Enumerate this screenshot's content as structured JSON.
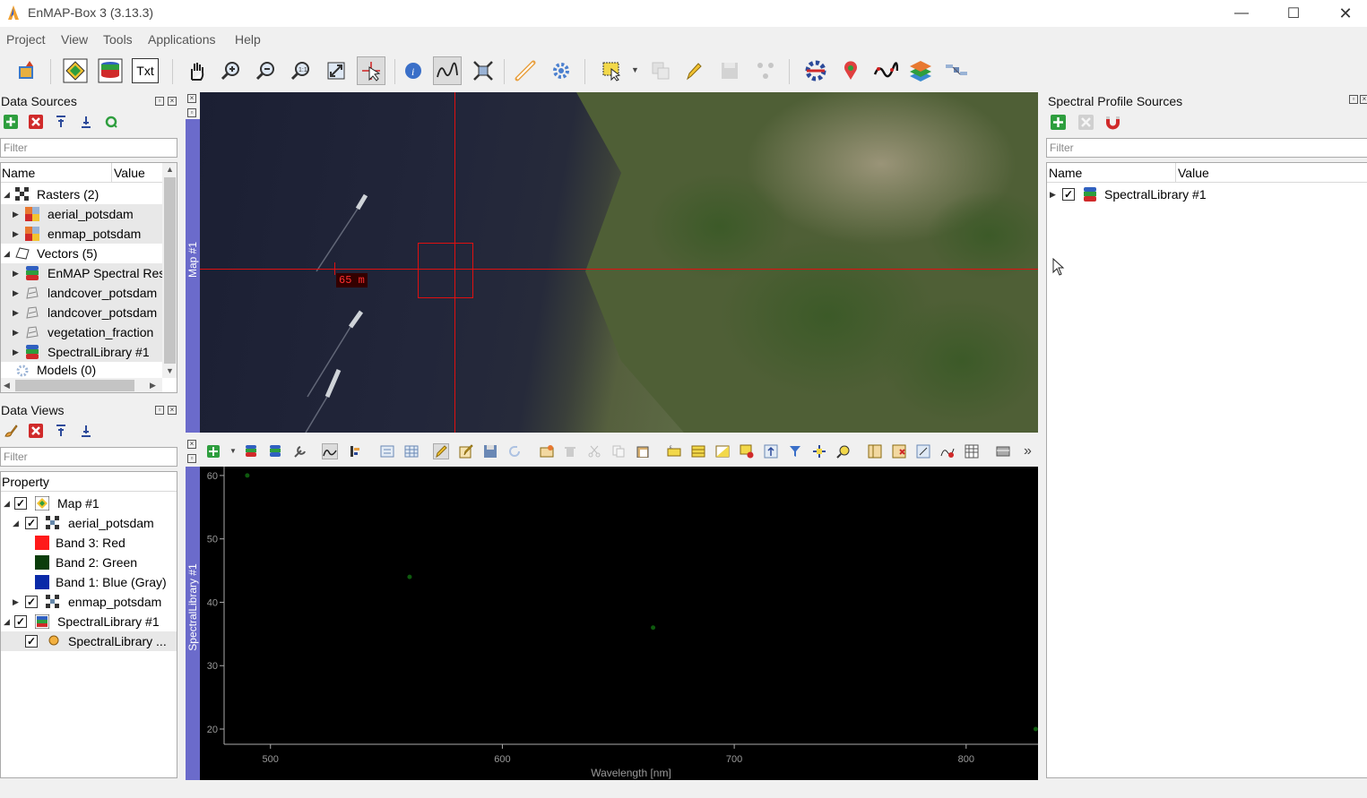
{
  "app": {
    "title": "EnMAP-Box 3 (3.13.3)"
  },
  "window_controls": {
    "minimize": "—",
    "maximize": "☐",
    "close": "✕"
  },
  "menu": [
    "Project",
    "View",
    "Tools",
    "Applications",
    "Help"
  ],
  "toolbar": {
    "txt_label": "Txt"
  },
  "data_sources": {
    "title": "Data Sources",
    "filter_placeholder": "Filter",
    "columns": [
      "Name",
      "Value"
    ],
    "items": [
      {
        "label": "Rasters (2)"
      },
      {
        "label": "aerial_potsdam"
      },
      {
        "label": "enmap_potsdam"
      },
      {
        "label": "Vectors (5)"
      },
      {
        "label": "EnMAP Spectral Res"
      },
      {
        "label": "landcover_potsdam"
      },
      {
        "label": "landcover_potsdam"
      },
      {
        "label": "vegetation_fraction"
      },
      {
        "label": "SpectralLibrary #1"
      },
      {
        "label": "Models (0)"
      }
    ]
  },
  "data_views": {
    "title": "Data Views",
    "filter_placeholder": "Filter",
    "column": "Property",
    "items": [
      {
        "label": "Map #1"
      },
      {
        "label": "aerial_potsdam"
      },
      {
        "label": "Band 3: Red",
        "color": "#ff1a1a"
      },
      {
        "label": "Band 2: Green",
        "color": "#0b3d0b"
      },
      {
        "label": "Band 1: Blue (Gray)",
        "color": "#0a2aa8"
      },
      {
        "label": "enmap_potsdam"
      },
      {
        "label": "SpectralLibrary #1"
      },
      {
        "label": "SpectralLibrary ..."
      }
    ]
  },
  "map": {
    "sidebar_label": "Map #1",
    "scale_text": "65 m"
  },
  "spectral_library": {
    "sidebar_label": "SpectralLibrary #1"
  },
  "chart_data": {
    "type": "scatter",
    "xlabel": "Wavelength [nm]",
    "ylabel": "",
    "xlim": [
      480,
      831
    ],
    "ylim": [
      17.6,
      61.4
    ],
    "x_ticks": [
      500,
      600,
      700,
      800
    ],
    "y_ticks": [
      20,
      30,
      40,
      50,
      60
    ],
    "grid": false,
    "points": [
      {
        "x": 490,
        "y": 60
      },
      {
        "x": 560,
        "y": 44
      },
      {
        "x": 665,
        "y": 36
      },
      {
        "x": 830,
        "y": 20
      }
    ],
    "point_color": "#0e5a0e"
  },
  "profile_sources": {
    "title": "Spectral Profile Sources",
    "filter_placeholder": "Filter",
    "columns": [
      "Name",
      "Value"
    ],
    "items": [
      {
        "label": "SpectralLibrary #1"
      }
    ]
  },
  "colors": {
    "accent": "#6b6bcb",
    "crosshair": "#e01010"
  }
}
